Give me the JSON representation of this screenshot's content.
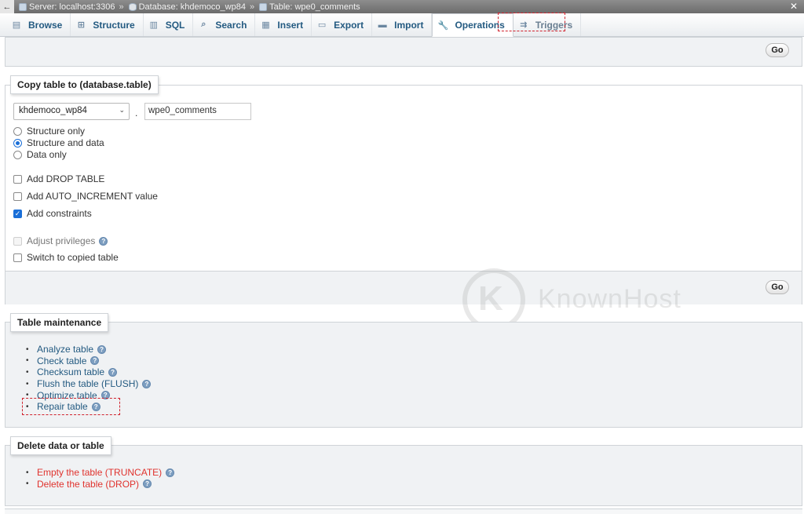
{
  "breadcrumb": {
    "server": "Server: localhost:3306",
    "database": "Database: khdemoco_wp84",
    "table": "Table: wpe0_comments",
    "separator": "»"
  },
  "tabs": [
    {
      "label": "Browse",
      "icon": "browse-icon"
    },
    {
      "label": "Structure",
      "icon": "structure-icon"
    },
    {
      "label": "SQL",
      "icon": "sql-icon"
    },
    {
      "label": "Search",
      "icon": "search-icon"
    },
    {
      "label": "Insert",
      "icon": "insert-icon"
    },
    {
      "label": "Export",
      "icon": "export-icon"
    },
    {
      "label": "Import",
      "icon": "import-icon"
    },
    {
      "label": "Operations",
      "icon": "wrench-icon",
      "active": true
    },
    {
      "label": "Triggers",
      "icon": "triggers-icon"
    }
  ],
  "top_panel": {
    "go_label": "Go"
  },
  "copy_table": {
    "legend": "Copy table to (database.table)",
    "database_select": "khdemoco_wp84",
    "dot": ".",
    "table_name": "wpe0_comments",
    "radios": [
      {
        "label": "Structure only",
        "checked": false
      },
      {
        "label": "Structure and data",
        "checked": true
      },
      {
        "label": "Data only",
        "checked": false
      }
    ],
    "checkboxes": [
      {
        "label": "Add DROP TABLE",
        "checked": false
      },
      {
        "label": "Add AUTO_INCREMENT value",
        "checked": false
      },
      {
        "label": "Add constraints",
        "checked": true
      }
    ],
    "adjust_privileges": "Adjust privileges",
    "switch_to_copied": "Switch to copied table",
    "go_label": "Go"
  },
  "maintenance": {
    "legend": "Table maintenance",
    "items": [
      "Analyze table",
      "Check table",
      "Checksum table",
      "Flush the table (FLUSH)",
      "Optimize table",
      "Repair table"
    ]
  },
  "delete": {
    "legend": "Delete data or table",
    "items": [
      "Empty the table (TRUNCATE)",
      "Delete the table (DROP)"
    ]
  },
  "watermark": {
    "logo_letter": "K",
    "text": "KnownHost"
  },
  "colors": {
    "link": "#235a81",
    "danger": "#e0332e",
    "highlight": "#d0212c",
    "accent": "#1a6fd8"
  }
}
